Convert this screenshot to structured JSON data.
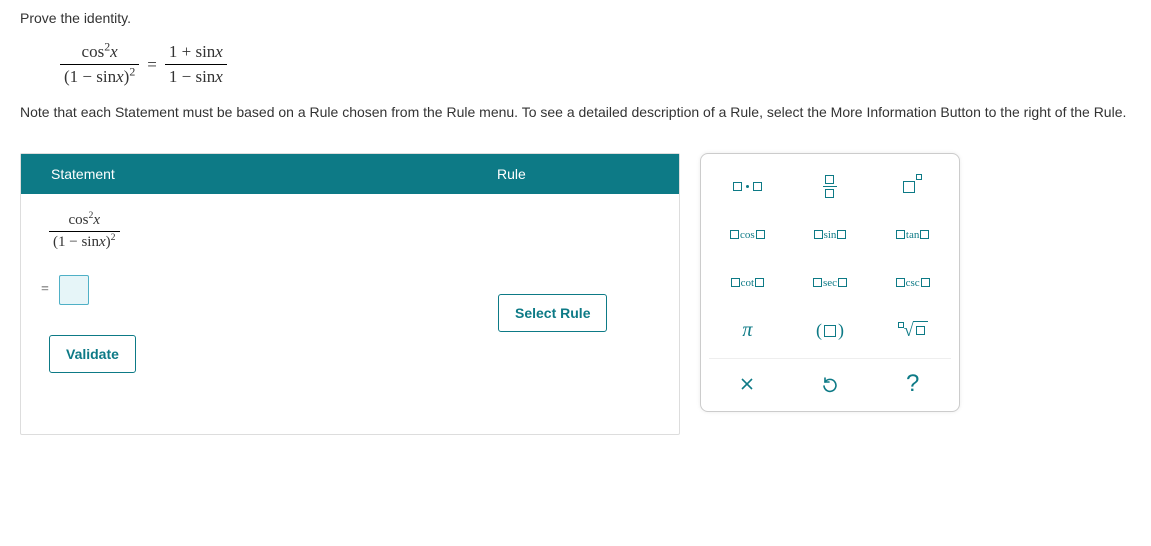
{
  "problem": {
    "title": "Prove the identity.",
    "identity_lhs_num": "cos",
    "identity_lhs_den_prefix": "(1 − sin",
    "identity_lhs_den_var": "x",
    "identity_lhs_den_suffix": ")",
    "identity_rhs_num": "1 + sin",
    "identity_rhs_den": "1 − sin",
    "var": "x",
    "note": "Note that each Statement must be based on a Rule chosen from the Rule menu. To see a detailed description of a Rule, select the More Information Button to the right of the Rule."
  },
  "panel": {
    "headers": {
      "statement": "Statement",
      "rule": "Rule"
    },
    "start_num_fn": "cos",
    "start_den_prefix": "(1 − sin",
    "start_den_var": "x",
    "start_den_suffix": ")",
    "equals": "=",
    "select_rule": "Select Rule",
    "validate": "Validate"
  },
  "palette": {
    "trig": {
      "cos": "cos",
      "sin": "sin",
      "tan": "tan",
      "cot": "cot",
      "sec": "sec",
      "csc": "csc"
    },
    "pi": "π"
  }
}
